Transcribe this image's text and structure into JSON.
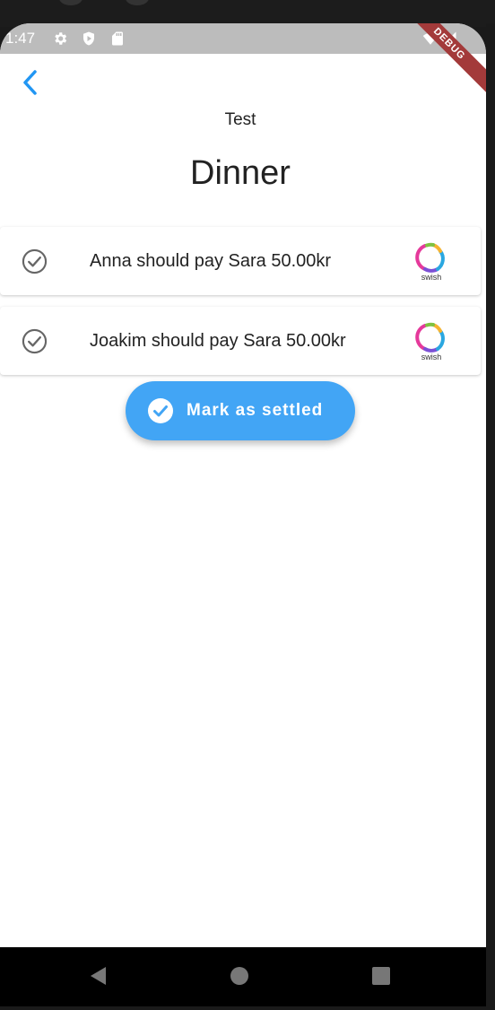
{
  "status_bar": {
    "time": "1:47",
    "debug_banner": "DEBUG"
  },
  "header": {
    "group_name": "Test",
    "expense_title": "Dinner"
  },
  "settlements": [
    {
      "text": "Anna should pay Sara 50.00kr",
      "pay_label": "swish"
    },
    {
      "text": "Joakim should pay Sara 50.00kr",
      "pay_label": "swish"
    }
  ],
  "actions": {
    "mark_settled_label": "Mark as settled"
  },
  "colors": {
    "accent": "#42a5f5",
    "status_bar": "#bcbcbc",
    "debug_ribbon": "#a33a3a"
  }
}
